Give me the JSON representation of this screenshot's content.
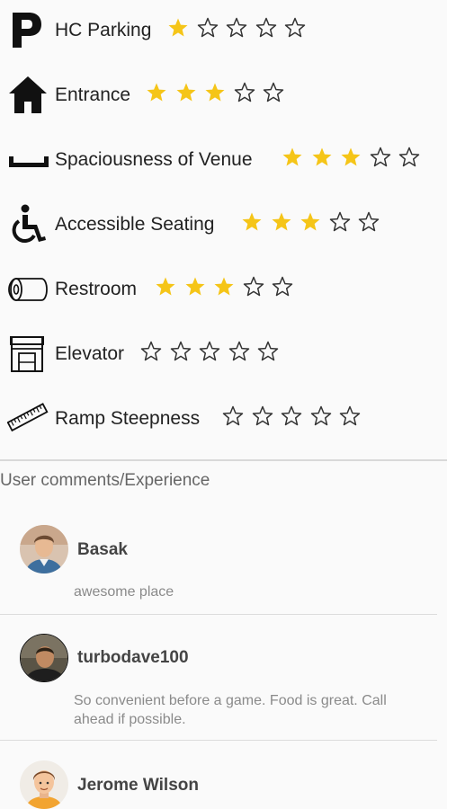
{
  "ratings": [
    {
      "label": "HC Parking",
      "icon": "parking-icon",
      "stars": 1,
      "max": 5
    },
    {
      "label": "Entrance",
      "icon": "house-icon",
      "stars": 3,
      "max": 5
    },
    {
      "label": "Spaciousness of Venue",
      "icon": "spaciousness-icon",
      "stars": 3,
      "max": 5
    },
    {
      "label": "Accessible Seating",
      "icon": "wheelchair-icon",
      "stars": 3,
      "max": 5
    },
    {
      "label": "Restroom",
      "icon": "toilet-paper-icon",
      "stars": 3,
      "max": 5
    },
    {
      "label": "Elevator",
      "icon": "elevator-icon",
      "stars": 0,
      "max": 5
    },
    {
      "label": "Ramp Steepness",
      "icon": "ramp-icon",
      "stars": 0,
      "max": 5
    }
  ],
  "colors": {
    "star_filled": "#f5c518",
    "star_empty_outline": "#333333",
    "text": "#222222",
    "muted_text": "#8a8a8a"
  },
  "comments_section": {
    "title": "User comments/Experience"
  },
  "comments": [
    {
      "name": "Basak",
      "text": "awesome place",
      "avatar": "avatar-photo-basak"
    },
    {
      "name": "turbodave100",
      "text": "So convenient before a game. Food is great. Call ahead if possible.",
      "avatar": "avatar-photo-turbodave100"
    },
    {
      "name": "Jerome Wilson",
      "text": "",
      "avatar": "avatar-cartoon-jerome"
    }
  ]
}
